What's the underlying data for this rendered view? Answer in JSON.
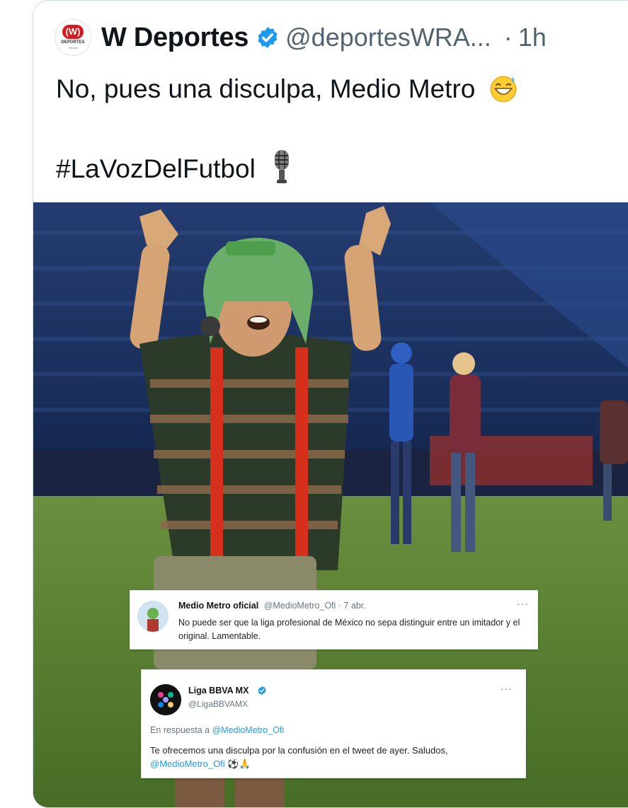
{
  "tweet": {
    "author_name": "W Deportes",
    "handle": "@deportesWRA...",
    "separator": "·",
    "time": "1h",
    "avatar_text": "(W)",
    "avatar_sub": "DEPORTES",
    "avatar_sub2": "730 AM",
    "line1": "No, pues una disculpa, Medio Metro",
    "line2": "#LaVozDelFutbol",
    "emoji1": "sweat-smile-emoji",
    "emoji2": "microphone-emoji"
  },
  "embedded_tweet_1": {
    "name": "Medio Metro oficial",
    "handle_time": "@MedioMetro_Ofi · 7 abr.",
    "text": "No puede ser que la liga profesional de México no sepa distinguir entre un imitador y el original. Lamentable.",
    "more": "···"
  },
  "embedded_tweet_2": {
    "name": "Liga BBVA MX",
    "handle": "@LigaBBVAMX",
    "more": "···",
    "reply_prefix": "En respuesta a ",
    "reply_handle": "@MedioMetro_Ofi",
    "text": "Te ofrecemos una disculpa por la confusión en el tweet de ayer. Saludos,",
    "mention": "@MedioMetro_Ofi",
    "emoji": "⚽🙏"
  },
  "colors": {
    "text": "#0f1419",
    "secondary": "#536471",
    "verified": "#1d9bf0",
    "card_border": "#cfd9de",
    "pitch": "#4f7a2e",
    "stands": "#1b3566"
  }
}
